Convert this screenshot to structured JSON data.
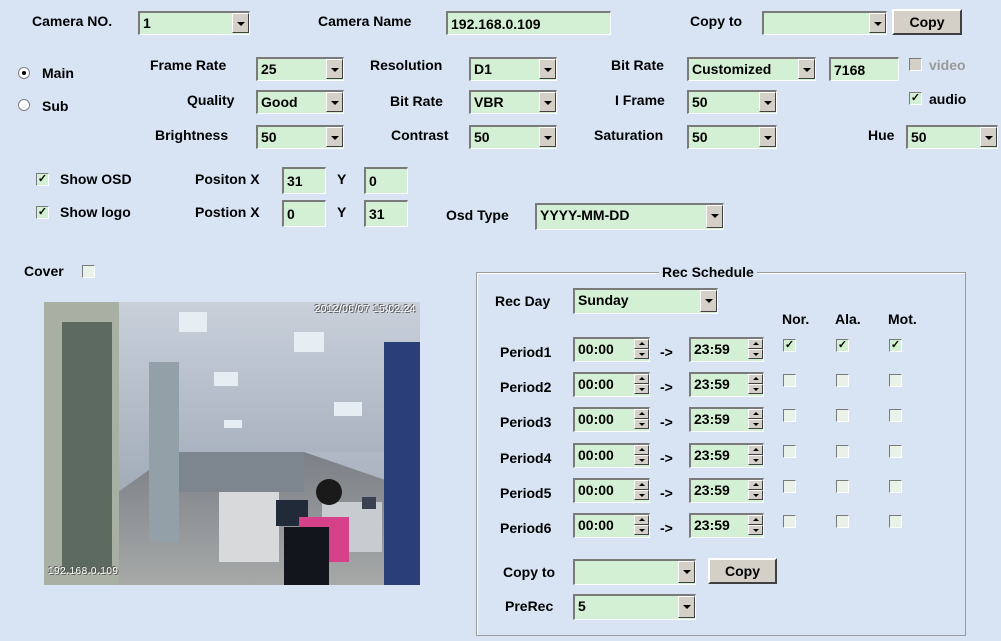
{
  "header": {
    "camera_no_label": "Camera NO.",
    "camera_no_value": "1",
    "camera_name_label": "Camera Name",
    "camera_name_value": "192.168.0.109",
    "copy_to_label": "Copy to",
    "copy_to_value": "",
    "copy_button": "Copy"
  },
  "stream": {
    "main_label": "Main",
    "sub_label": "Sub",
    "selected": "Main"
  },
  "encoding": {
    "frame_rate_label": "Frame Rate",
    "frame_rate_value": "25",
    "resolution_label": "Resolution",
    "resolution_value": "D1",
    "bit_rate_type_label": "Bit Rate",
    "bit_rate_type_value": "Customized",
    "bit_rate_custom_value": "7168",
    "video_label": "video",
    "quality_label": "Quality",
    "quality_value": "Good",
    "bit_rate_mode_label": "Bit Rate",
    "bit_rate_mode_value": "VBR",
    "iframe_label": "I Frame",
    "iframe_value": "50",
    "audio_label": "audio",
    "brightness_label": "Brightness",
    "brightness_value": "50",
    "contrast_label": "Contrast",
    "contrast_value": "50",
    "saturation_label": "Saturation",
    "saturation_value": "50",
    "hue_label": "Hue",
    "hue_value": "50"
  },
  "osd": {
    "show_osd_label": "Show OSD",
    "show_logo_label": "Show logo",
    "osd_pos_x_label": "Positon X",
    "osd_x": "31",
    "osd_y_label": "Y",
    "osd_y": "0",
    "logo_pos_x_label": "Postion X",
    "logo_x": "0",
    "logo_y_label": "Y",
    "logo_y": "31",
    "osd_type_label": "Osd Type",
    "osd_type_value": "YYYY-MM-DD"
  },
  "cover": {
    "label": "Cover"
  },
  "preview": {
    "timestamp": "2012/06/07 15:02:24",
    "logo": "192.168.0.109"
  },
  "schedule": {
    "title": "Rec Schedule",
    "rec_day_label": "Rec Day",
    "rec_day_value": "Sunday",
    "col_nor": "Nor.",
    "col_ala": "Ala.",
    "col_mot": "Mot.",
    "arrow": "->",
    "periods": [
      {
        "label": "Period1",
        "start": "00:00",
        "end": "23:59",
        "nor": true,
        "ala": true,
        "mot": true
      },
      {
        "label": "Period2",
        "start": "00:00",
        "end": "23:59",
        "nor": false,
        "ala": false,
        "mot": false
      },
      {
        "label": "Period3",
        "start": "00:00",
        "end": "23:59",
        "nor": false,
        "ala": false,
        "mot": false
      },
      {
        "label": "Period4",
        "start": "00:00",
        "end": "23:59",
        "nor": false,
        "ala": false,
        "mot": false
      },
      {
        "label": "Period5",
        "start": "00:00",
        "end": "23:59",
        "nor": false,
        "ala": false,
        "mot": false
      },
      {
        "label": "Period6",
        "start": "00:00",
        "end": "23:59",
        "nor": false,
        "ala": false,
        "mot": false
      }
    ],
    "copy_to_label": "Copy to",
    "copy_to_value": "",
    "copy_button": "Copy",
    "prerec_label": "PreRec",
    "prerec_value": "5"
  }
}
